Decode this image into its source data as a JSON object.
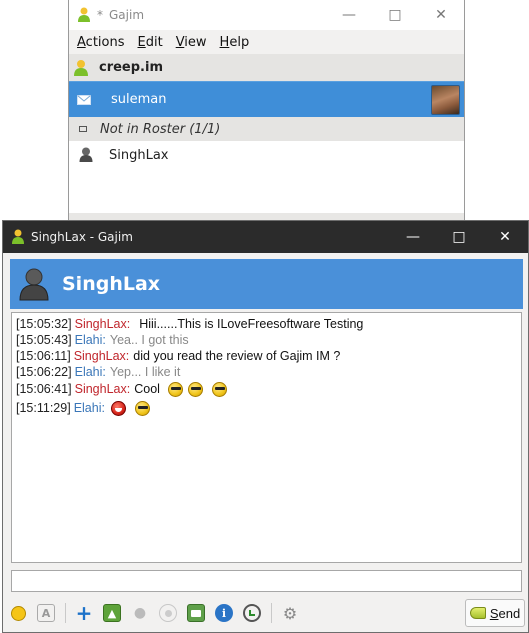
{
  "roster": {
    "title": "Gajim",
    "title_prefix": "*",
    "menu": [
      {
        "mnemonic": "A",
        "rest": "ctions"
      },
      {
        "mnemonic": "E",
        "rest": "dit"
      },
      {
        "mnemonic": "V",
        "rest": "iew"
      },
      {
        "mnemonic": "H",
        "rest": "elp"
      }
    ],
    "account": "creep.im",
    "selected_contact": "suleman",
    "group": "Not in Roster (1/1)",
    "contact": "SinghLax"
  },
  "chat": {
    "title": "SinghLax - Gajim",
    "banner_name": "SinghLax",
    "messages": [
      {
        "time": "[15:05:32]",
        "nick": "SinghLax:",
        "text": "Hiii......This is ILoveFreesoftware Testing",
        "from": "them",
        "emoticons": []
      },
      {
        "time": "[15:05:43]",
        "nick": "Elahi:",
        "text": "Yea.. I got this",
        "from": "me",
        "emoticons": []
      },
      {
        "time": "[15:06:11]",
        "nick": "SinghLax:",
        "text": "did you read the review of Gajim IM ?",
        "from": "them",
        "emoticons": []
      },
      {
        "time": "[15:06:22]",
        "nick": "Elahi:",
        "text": "Yep... I like it",
        "from": "me",
        "emoticons": []
      },
      {
        "time": "[15:06:41]",
        "nick": "SinghLax:",
        "text": "Cool",
        "from": "them",
        "emoticons": [
          "cool-smiley-icon",
          "cool-smiley-icon",
          "cool-smiley-icon"
        ]
      },
      {
        "time": "[15:11:29]",
        "nick": "Elahi:",
        "text": "",
        "from": "me",
        "emoticons": [
          "devil-smiley-icon",
          "cool-smiley-icon"
        ]
      }
    ],
    "input_value": "",
    "send_label": "Send",
    "send_mnemonic": "S",
    "send_rest": "end"
  },
  "colors": {
    "selection": "#3f8ed8",
    "banner": "#4a90d9",
    "nick_them": "#c0262c",
    "nick_me": "#3a76b8"
  }
}
